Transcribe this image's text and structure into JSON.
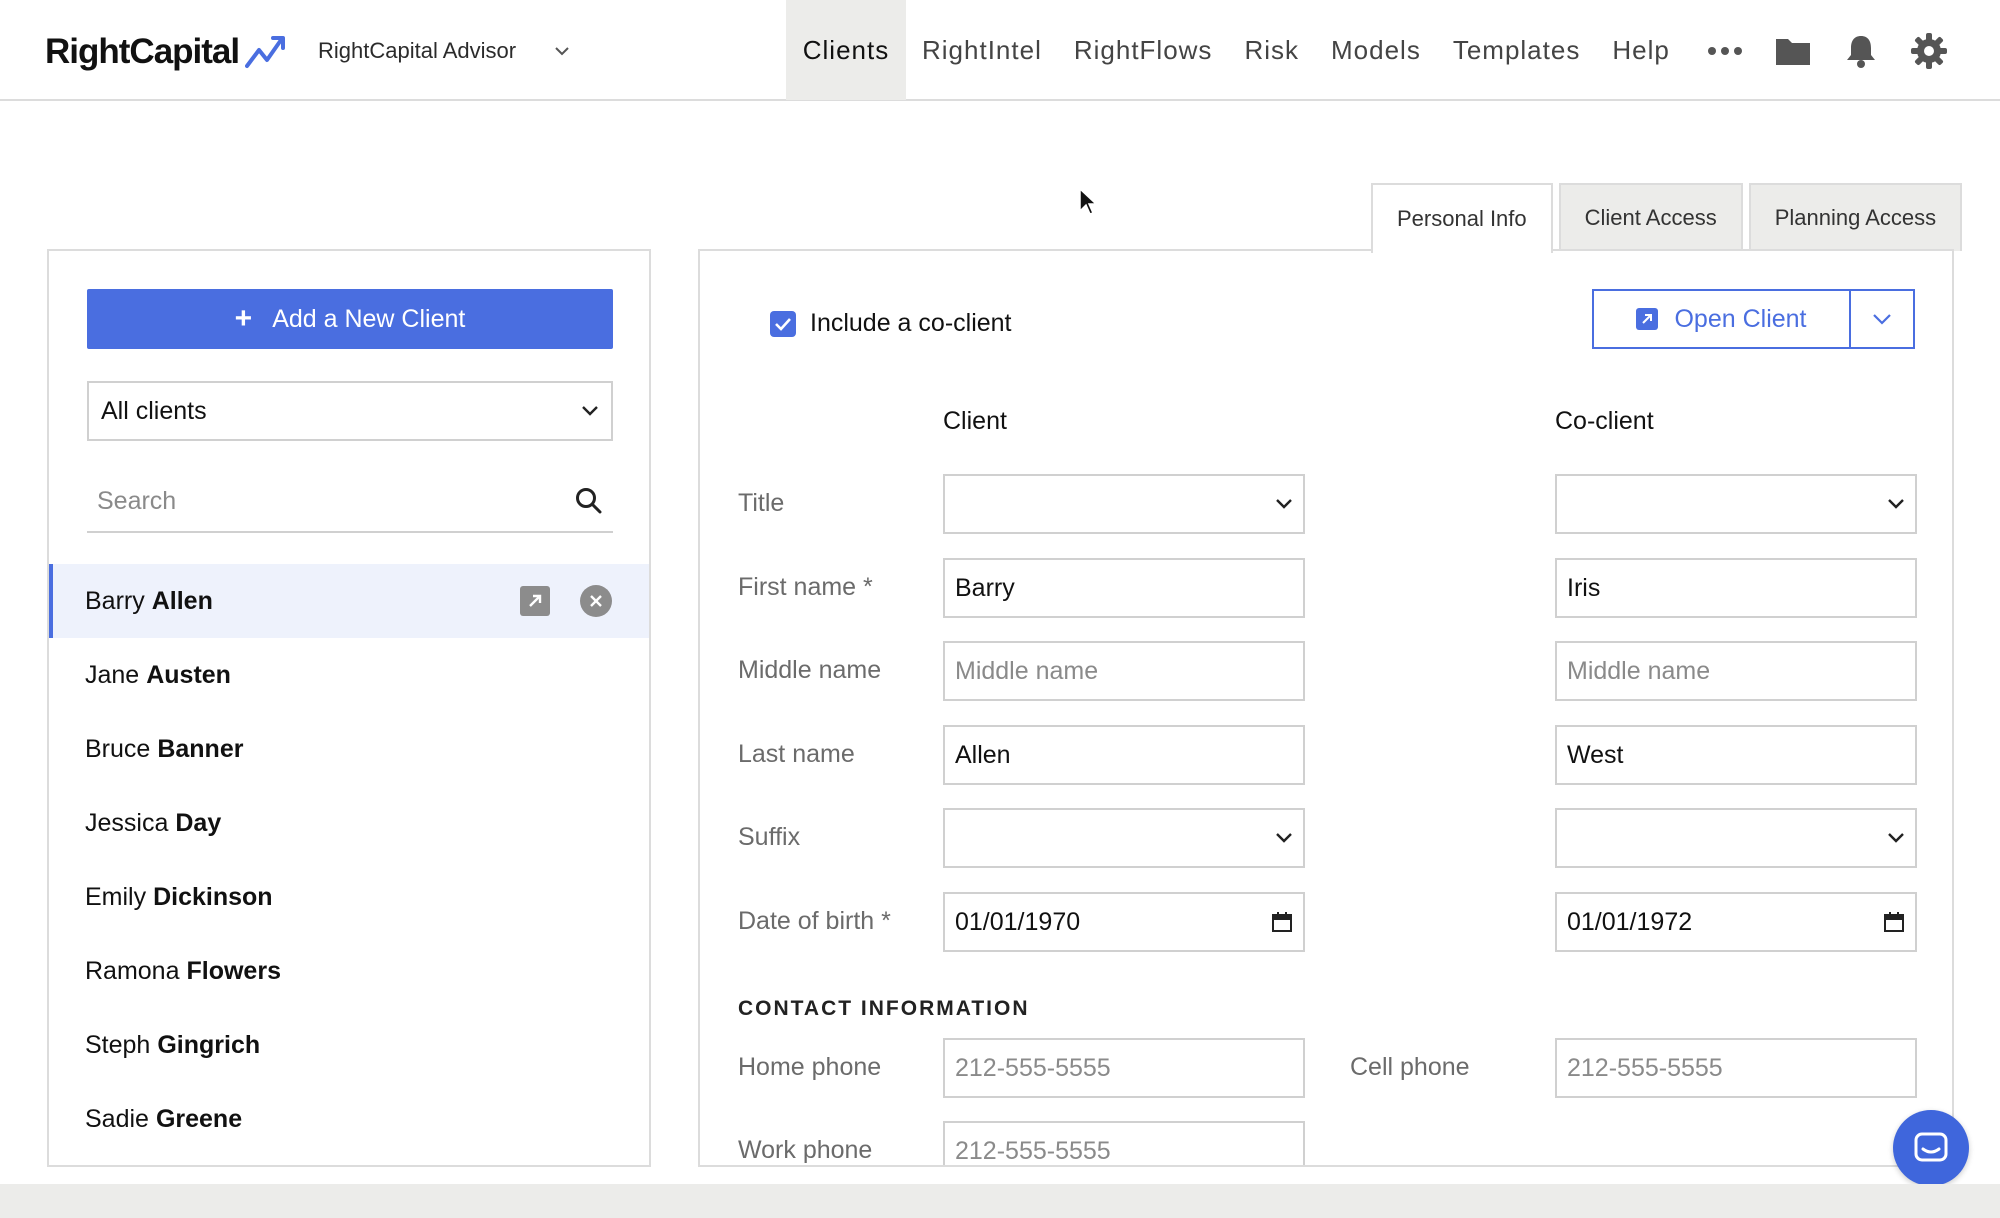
{
  "brand": {
    "name": "RightCapital",
    "accent": "#4a6ee0"
  },
  "advisor": {
    "label": "RightCapital Advisor"
  },
  "nav": {
    "items": [
      "Clients",
      "RightIntel",
      "RightFlows",
      "Risk",
      "Models",
      "Templates",
      "Help"
    ],
    "active": "Clients",
    "icons": [
      "more-icon",
      "folder-icon",
      "bell-icon",
      "gear-icon"
    ]
  },
  "left": {
    "add_button": "Add a New Client",
    "filter": "All clients",
    "search_placeholder": "Search",
    "clients": [
      {
        "first": "Barry",
        "last": "Allen",
        "selected": true
      },
      {
        "first": "Jane",
        "last": "Austen"
      },
      {
        "first": "Bruce",
        "last": "Banner"
      },
      {
        "first": "Jessica",
        "last": "Day"
      },
      {
        "first": "Emily",
        "last": "Dickinson"
      },
      {
        "first": "Ramona",
        "last": "Flowers"
      },
      {
        "first": "Steph",
        "last": "Gingrich"
      },
      {
        "first": "Sadie",
        "last": "Greene"
      }
    ]
  },
  "tabs": [
    "Personal Info",
    "Client Access",
    "Planning Access"
  ],
  "active_tab": "Personal Info",
  "form": {
    "include_coclient": "Include a co-client",
    "open_client": "Open Client",
    "col_client": "Client",
    "col_coclient": "Co-client",
    "labels": {
      "title": "Title",
      "first_name": "First name *",
      "middle_name": "Middle name",
      "last_name": "Last name",
      "suffix": "Suffix",
      "dob": "Date of birth *"
    },
    "client": {
      "title": "",
      "first_name": "Barry",
      "middle_placeholder": "Middle name",
      "last_name": "Allen",
      "suffix": "",
      "dob": "01/01/1970"
    },
    "coclient": {
      "title": "",
      "first_name": "Iris",
      "middle_placeholder": "Middle name",
      "last_name": "West",
      "suffix": "",
      "dob": "01/01/1972"
    },
    "contact_title": "CONTACT INFORMATION",
    "contact": {
      "home_label": "Home phone",
      "home_placeholder": "212-555-5555",
      "cell_label": "Cell phone",
      "cell_placeholder": "212-555-5555",
      "work_label": "Work phone",
      "work_placeholder": "212-555-5555"
    }
  }
}
